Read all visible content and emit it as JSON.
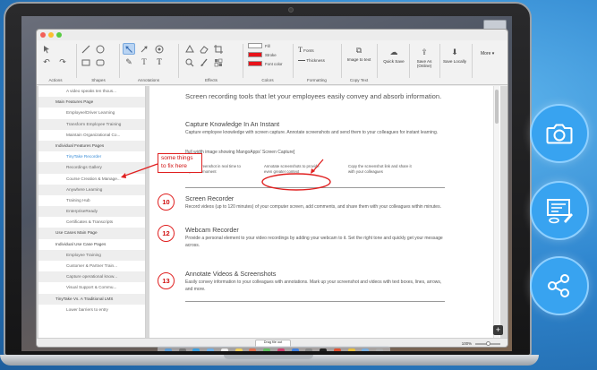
{
  "toolbar": {
    "groups": {
      "actions": "Actions",
      "shapes": "Shapes",
      "annotations": "Annotations",
      "effects": "Effects",
      "colors": "Colors",
      "formatting": "Formatting",
      "copy_text": "Copy Text"
    },
    "colors": {
      "fill_label": "Fill",
      "stroke_label": "Stroke",
      "font_color_label": "Font color",
      "stroke_color": "#e8131a",
      "font_color": "#e8131a"
    },
    "formatting": {
      "fonts_label": "Fonts",
      "thickness_label": "Thickness"
    },
    "image_to_text": "Image to text",
    "quick_save": "Quick Save",
    "save_as": "Save As (Online)",
    "save_locally": "Save Locally",
    "more": "More"
  },
  "sidebar": {
    "items": [
      {
        "label": "A video speaks ten thous...",
        "level": 2
      },
      {
        "label": "Main Features Page",
        "level": 1
      },
      {
        "label": "Employee/Driver Learning",
        "level": 2
      },
      {
        "label": "Transform Employee Training",
        "level": 2
      },
      {
        "label": "Maintain Organizational Co...",
        "level": 2
      },
      {
        "label": "Individual Features Pages",
        "level": 1
      },
      {
        "label": "TinyTake Recorder",
        "level": 2,
        "active": true
      },
      {
        "label": "Recordings Gallery",
        "level": 2
      },
      {
        "label": "Course Creation & Manage...",
        "level": 2
      },
      {
        "label": "Anywhere Learning",
        "level": 2
      },
      {
        "label": "Training Hub",
        "level": 2
      },
      {
        "label": "EnterpriseReady",
        "level": 2
      },
      {
        "label": "Certificates & Transcripts",
        "level": 2
      },
      {
        "label": "Use Cases Main Page",
        "level": 1
      },
      {
        "label": "Individual Use Case Pages",
        "level": 1
      },
      {
        "label": "Employee Training",
        "level": 2
      },
      {
        "label": "Customer & Partner Train...",
        "level": 2
      },
      {
        "label": "Capture operational know...",
        "level": 2
      },
      {
        "label": "Visual Support & Commu...",
        "level": 2
      },
      {
        "label": "TinyTake Vs. A Traditional LMS",
        "level": 1
      },
      {
        "label": "Lower barriers to entry",
        "level": 2
      }
    ]
  },
  "document": {
    "lead": "Screen recording tools that let your employees easily convey and absorb information.",
    "section1": {
      "title": "Capture Knowledge In An Instant",
      "body": "Capture employee knowledge with screen capture. Annotate screenshots and send them to your colleagues for instant learning.",
      "image_note": "[full width image showing MangoApps' Screen Capture]",
      "columns": [
        "Take a screenshot in real time to capture a moment",
        "Annotate screenshots to provide even greater context",
        "Copy the screenshot link and share it with your colleagues"
      ]
    },
    "section2": {
      "number": "10",
      "title": "Screen Recorder",
      "body": "Record videos (up to 120 minutes) of your computer screen, add comments, and share them with your colleagues within minutes."
    },
    "section3": {
      "number": "12",
      "title": "Webcam Recorder",
      "body": "Provide a personal element to your video recordings by adding your webcam to it. Set the right tone and quickly get your message across."
    },
    "section4": {
      "number": "13",
      "title": "Annotate Videos & Screenshots",
      "body": "Easily convey information to your colleagues with annotations. Mark up your screenshot and videos with text boxes, lines, arrows, and more."
    }
  },
  "annotation": {
    "callout_text": "some things to fix here",
    "accent_color": "#e02020"
  },
  "statusbar": {
    "drag_file": "Drag file out",
    "zoom": "100%"
  },
  "features": [
    "camera-icon",
    "whiteboard-icon",
    "share-icon"
  ],
  "colors": {
    "background": "#2f86cf",
    "feature_circle": "#38a3f0",
    "link_blue": "#3b8ed8"
  }
}
